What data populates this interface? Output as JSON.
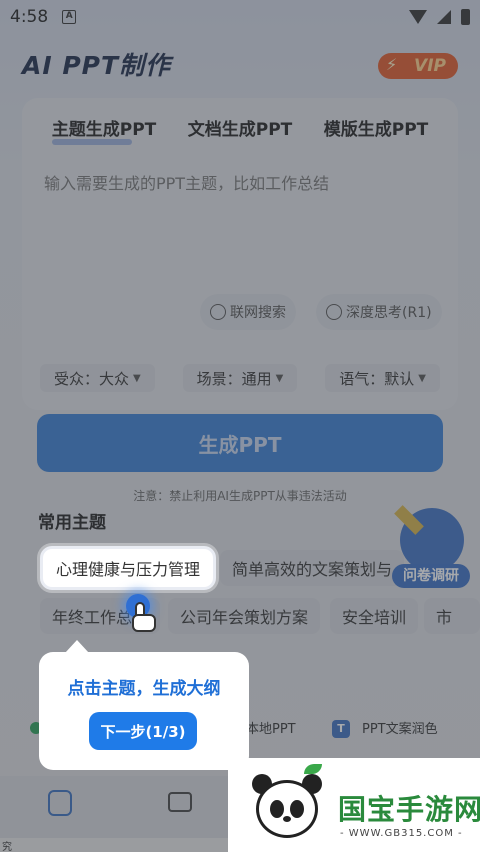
{
  "status": {
    "time": "4:58",
    "a_icon": "A"
  },
  "header": {
    "title": "AI PPT制作",
    "vip": "VIP"
  },
  "tabs": [
    {
      "label": "主题生成PPT"
    },
    {
      "label": "文档生成PPT"
    },
    {
      "label": "模版生成PPT"
    }
  ],
  "input": {
    "placeholder": "输入需要生成的PPT主题，比如工作总结"
  },
  "options": {
    "web_search": "联网搜索",
    "deep_think": "深度思考(R1)"
  },
  "selects": [
    {
      "label": "受众：大众"
    },
    {
      "label": "场景：通用"
    },
    {
      "label": "语气：默认"
    }
  ],
  "generate_label": "生成PPT",
  "notice": "注意：禁止利用AI生成PPT从事违法活动",
  "topics": {
    "title": "常用主题",
    "row1": [
      "心理健康与压力管理",
      "简单高效的文案策划与"
    ],
    "row2": [
      "年终工作总结",
      "公司年会策划方案",
      "安全培训",
      "市"
    ]
  },
  "survey_label": "问卷调研",
  "tools": {
    "local_ppt": "本地PPT",
    "ppt_polish_badge": "T",
    "ppt_polish": "PPT文案润色"
  },
  "guide": {
    "text": "点击主题，生成大纲",
    "next": "下一步(1/3)"
  },
  "bottom_strip": "究",
  "watermark": {
    "brand": "国宝手游网",
    "url": "- WWW.GB315.COM -"
  },
  "colors": {
    "primary": "#1f7be8",
    "generate_button": "#3a7fd3",
    "vip": "#e05a2a",
    "watermark_green": "#2a8a3c"
  }
}
